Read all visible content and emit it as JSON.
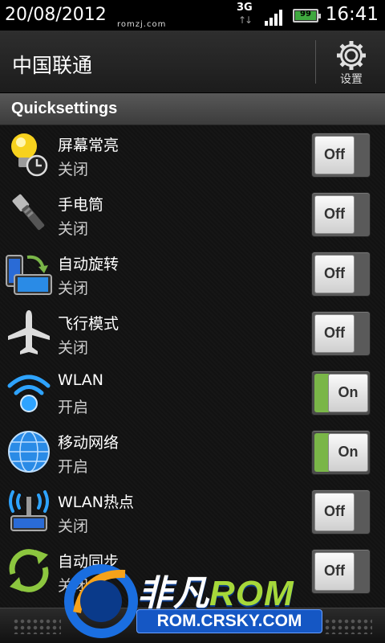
{
  "status_bar": {
    "date": "20/08/2012",
    "watermark": "romzj.com",
    "network_type": "3G",
    "battery_level": "99",
    "time": "16:41"
  },
  "header": {
    "carrier": "中国联通",
    "settings_label": "设置"
  },
  "section_title": "Quicksettings",
  "items": [
    {
      "title": "屏幕常亮",
      "status": "关闭",
      "toggle": "Off",
      "icon": "bulb-clock-icon"
    },
    {
      "title": "手电筒",
      "status": "关闭",
      "toggle": "Off",
      "icon": "flashlight-icon"
    },
    {
      "title": "自动旋转",
      "status": "关闭",
      "toggle": "Off",
      "icon": "rotate-icon"
    },
    {
      "title": "飞行模式",
      "status": "关闭",
      "toggle": "Off",
      "icon": "airplane-icon"
    },
    {
      "title": "WLAN",
      "status": "开启",
      "toggle": "On",
      "icon": "wifi-icon"
    },
    {
      "title": "移动网络",
      "status": "开启",
      "toggle": "On",
      "icon": "globe-icon"
    },
    {
      "title": "WLAN热点",
      "status": "关闭",
      "toggle": "Off",
      "icon": "hotspot-icon"
    },
    {
      "title": "自动同步",
      "status": "关闭",
      "toggle": "Off",
      "icon": "sync-icon"
    }
  ],
  "watermark_logo": {
    "brand_cn": "非凡",
    "brand_rom": "ROM",
    "site": "ROM.CRSKY.COM"
  },
  "colors": {
    "toggle_on": "#7ab648",
    "section_bg": "#4a4a4a"
  }
}
